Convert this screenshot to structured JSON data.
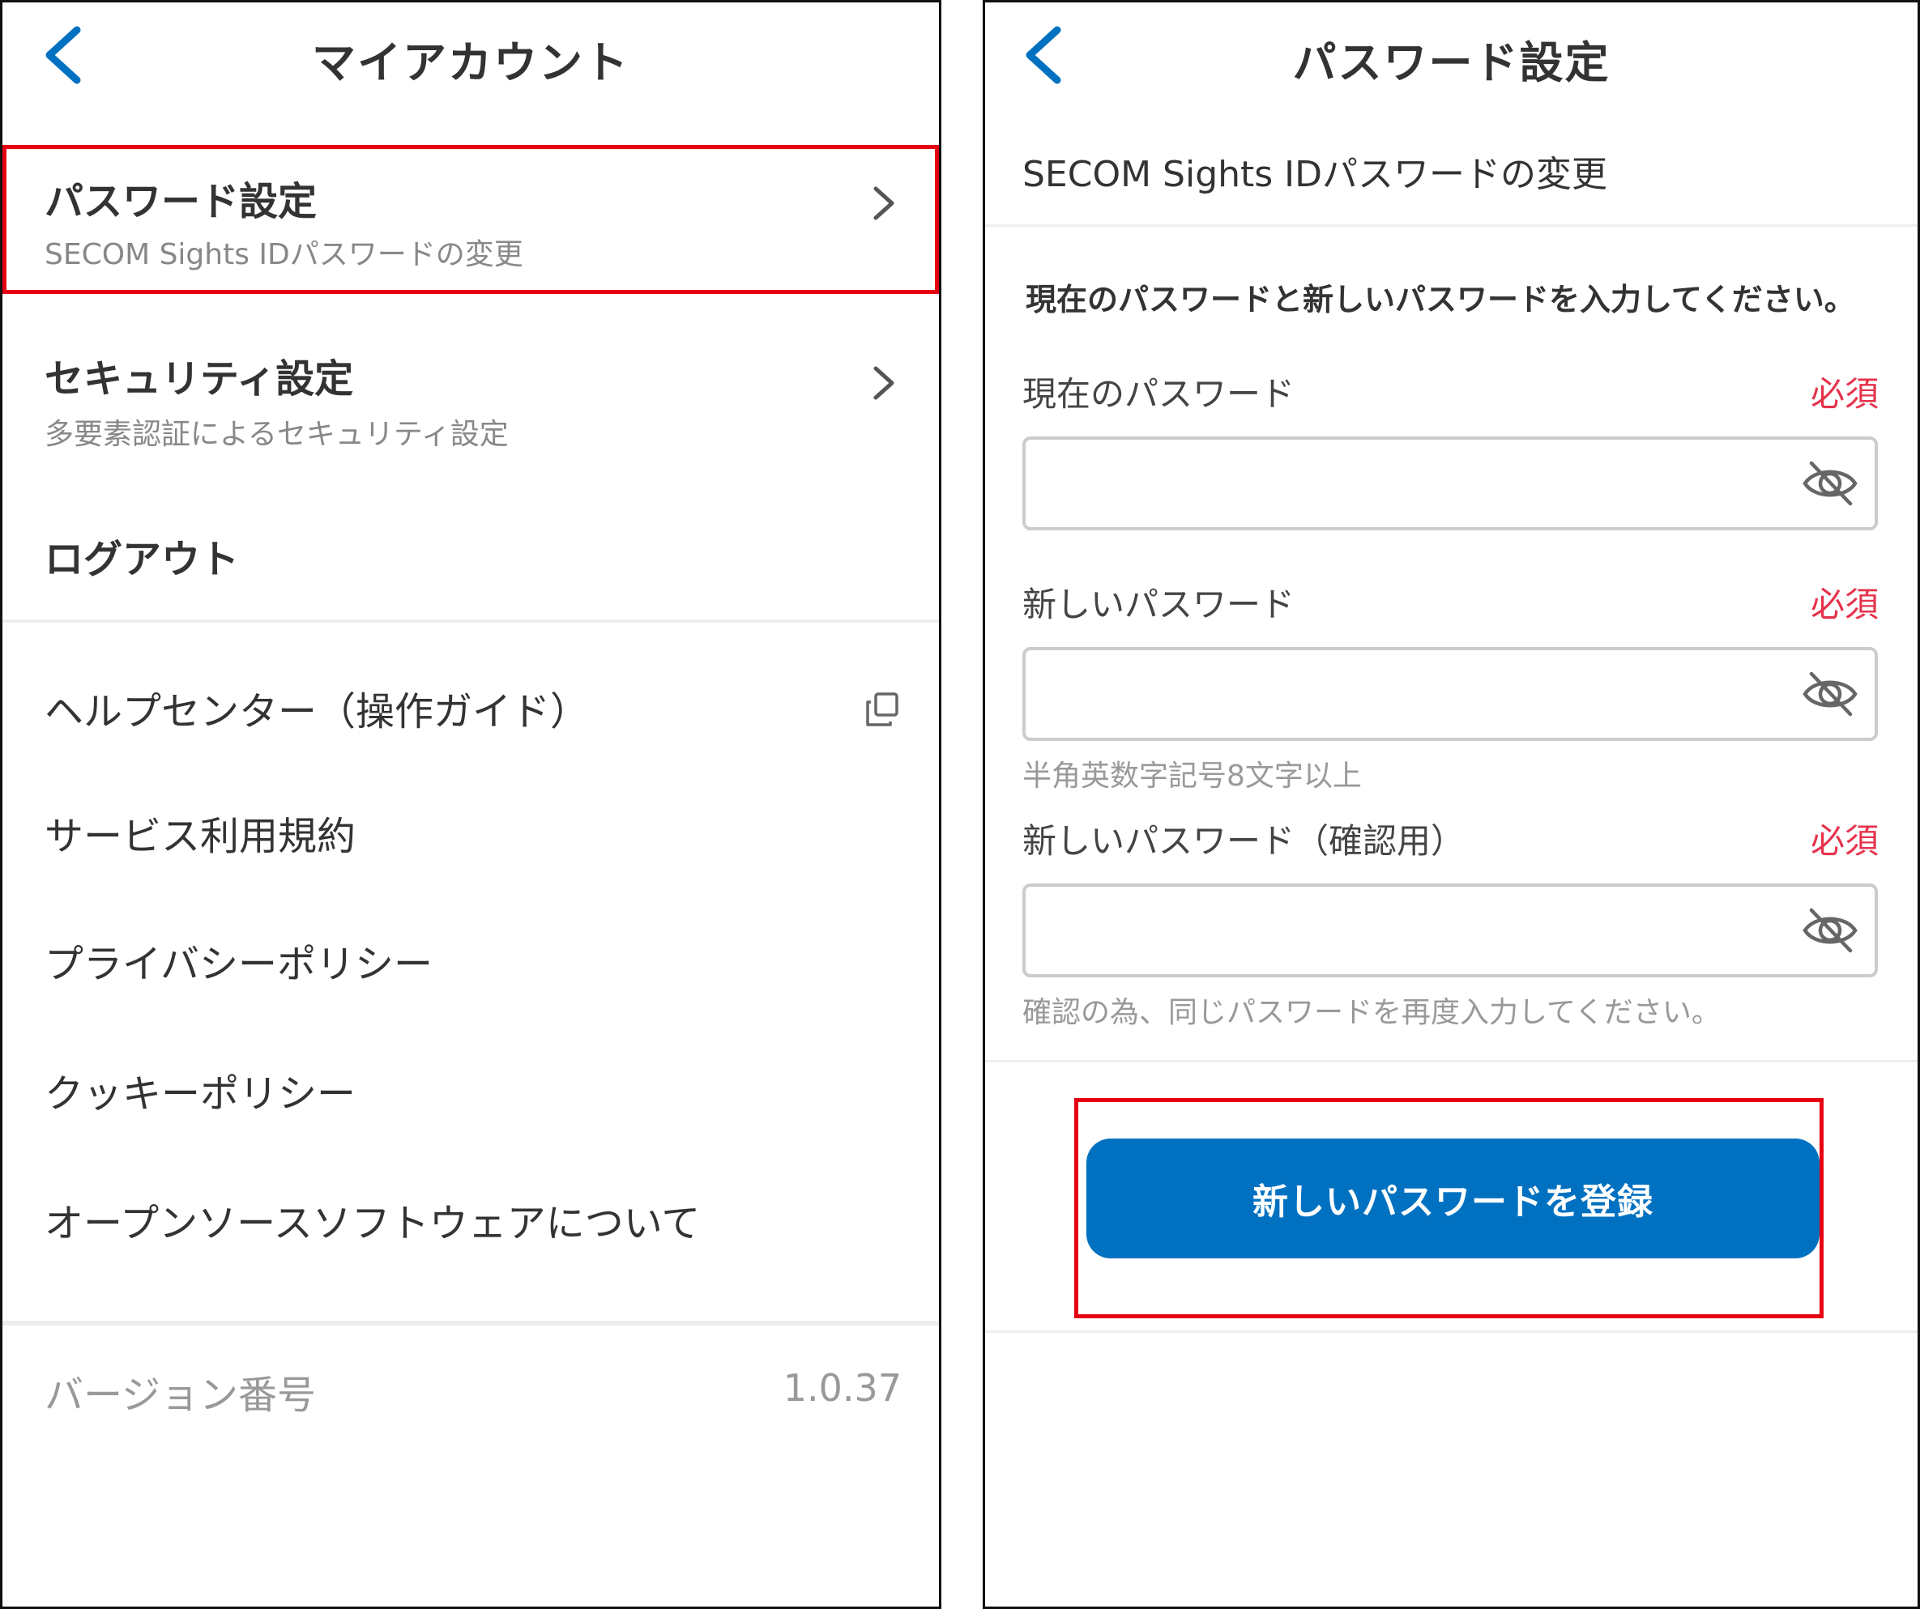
{
  "left": {
    "header": {
      "title": "マイアカウント",
      "back_icon": "chevron-left-icon"
    },
    "password_row": {
      "title": "パスワード設定",
      "subtitle": "SECOM Sights IDパスワードの変更"
    },
    "security_row": {
      "title": "セキュリティ設定",
      "subtitle": "多要素認証によるセキュリティ設定"
    },
    "logout": "ログアウト",
    "links": {
      "help": "ヘルプセンター（操作ガイド）",
      "terms": "サービス利用規約",
      "privacy": "プライバシーポリシー",
      "cookie": "クッキーポリシー",
      "oss": "オープンソースソフトウェアについて"
    },
    "version": {
      "label": "バージョン番号",
      "value": "1.0.37"
    }
  },
  "right": {
    "header": {
      "title": "パスワード設定",
      "back_icon": "chevron-left-icon"
    },
    "subheading": "SECOM Sights IDパスワードの変更",
    "instruction": "現在のパスワードと新しいパスワードを入力してください。",
    "fields": [
      {
        "label": "現在のパスワード",
        "required": "必須",
        "value": "",
        "hint": ""
      },
      {
        "label": "新しいパスワード",
        "required": "必須",
        "value": "",
        "hint": "半角英数字記号8文字以上"
      },
      {
        "label": "新しいパスワード（確認用）",
        "required": "必須",
        "value": "",
        "hint": "確認の為、同じパスワードを再度入力してください。"
      }
    ],
    "submit_label": "新しいパスワードを登録"
  },
  "colors": {
    "accent_blue": "#0071c1",
    "required_red": "#e5324b",
    "highlight_red": "#e60012"
  }
}
